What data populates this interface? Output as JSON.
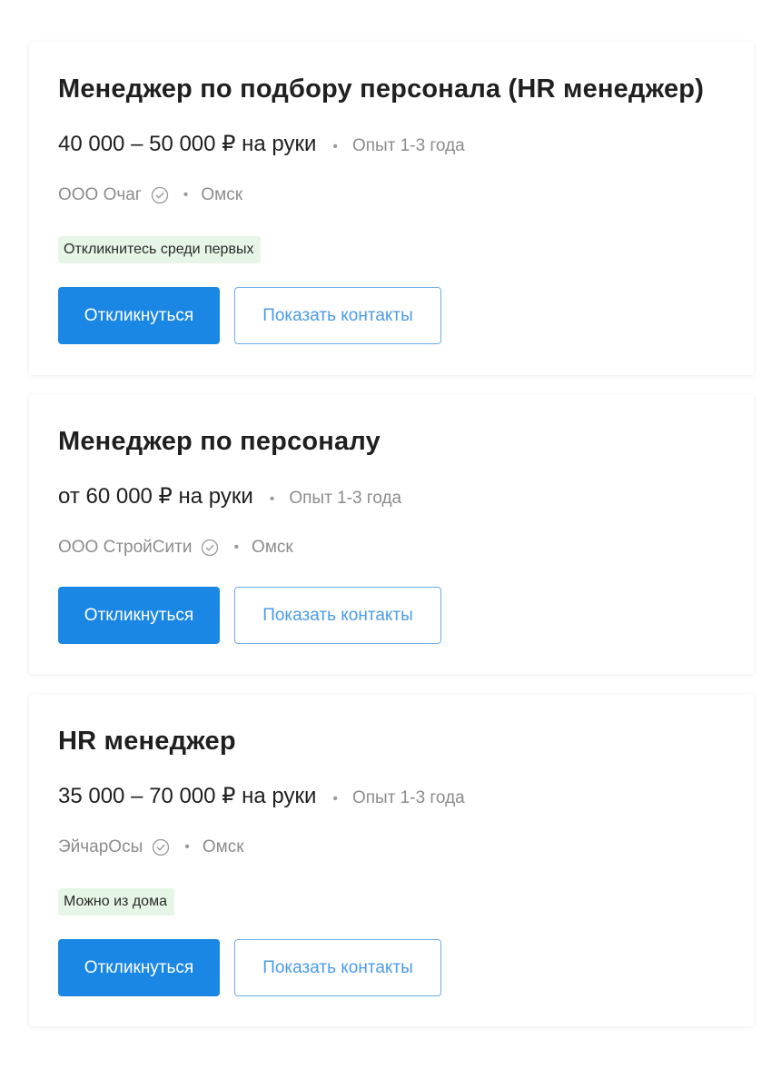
{
  "vacancies": [
    {
      "title": "Менеджер по подбору персонала (HR менеджер)",
      "salary": "40 000 – 50 000 ₽ на руки",
      "experience": "Опыт 1-3 года",
      "company": "ООО Очаг",
      "city": "Омск",
      "badge": "Откликнитесь среди первых",
      "respond_label": "Откликнуться",
      "contacts_label": "Показать контакты"
    },
    {
      "title": "Менеджер по персоналу",
      "salary": "от 60 000 ₽ на руки",
      "experience": "Опыт 1-3 года",
      "company": "ООО СтройСити",
      "city": "Омск",
      "respond_label": "Откликнуться",
      "contacts_label": "Показать контакты"
    },
    {
      "title": "HR менеджер",
      "salary": "35 000 – 70 000 ₽ на руки",
      "experience": "Опыт 1-3 года",
      "company": "ЭйчарОсы",
      "city": "Омск",
      "badge": "Можно из дома",
      "respond_label": "Откликнуться",
      "contacts_label": "Показать контакты"
    }
  ],
  "separator": "•",
  "icons": {
    "verified": "verified-check-icon"
  },
  "colors": {
    "primary_button": "#1a87e4",
    "outline_button_text": "#4a9be6",
    "badge_background": "#e6f6e6",
    "muted_text": "#8c8c8c"
  }
}
